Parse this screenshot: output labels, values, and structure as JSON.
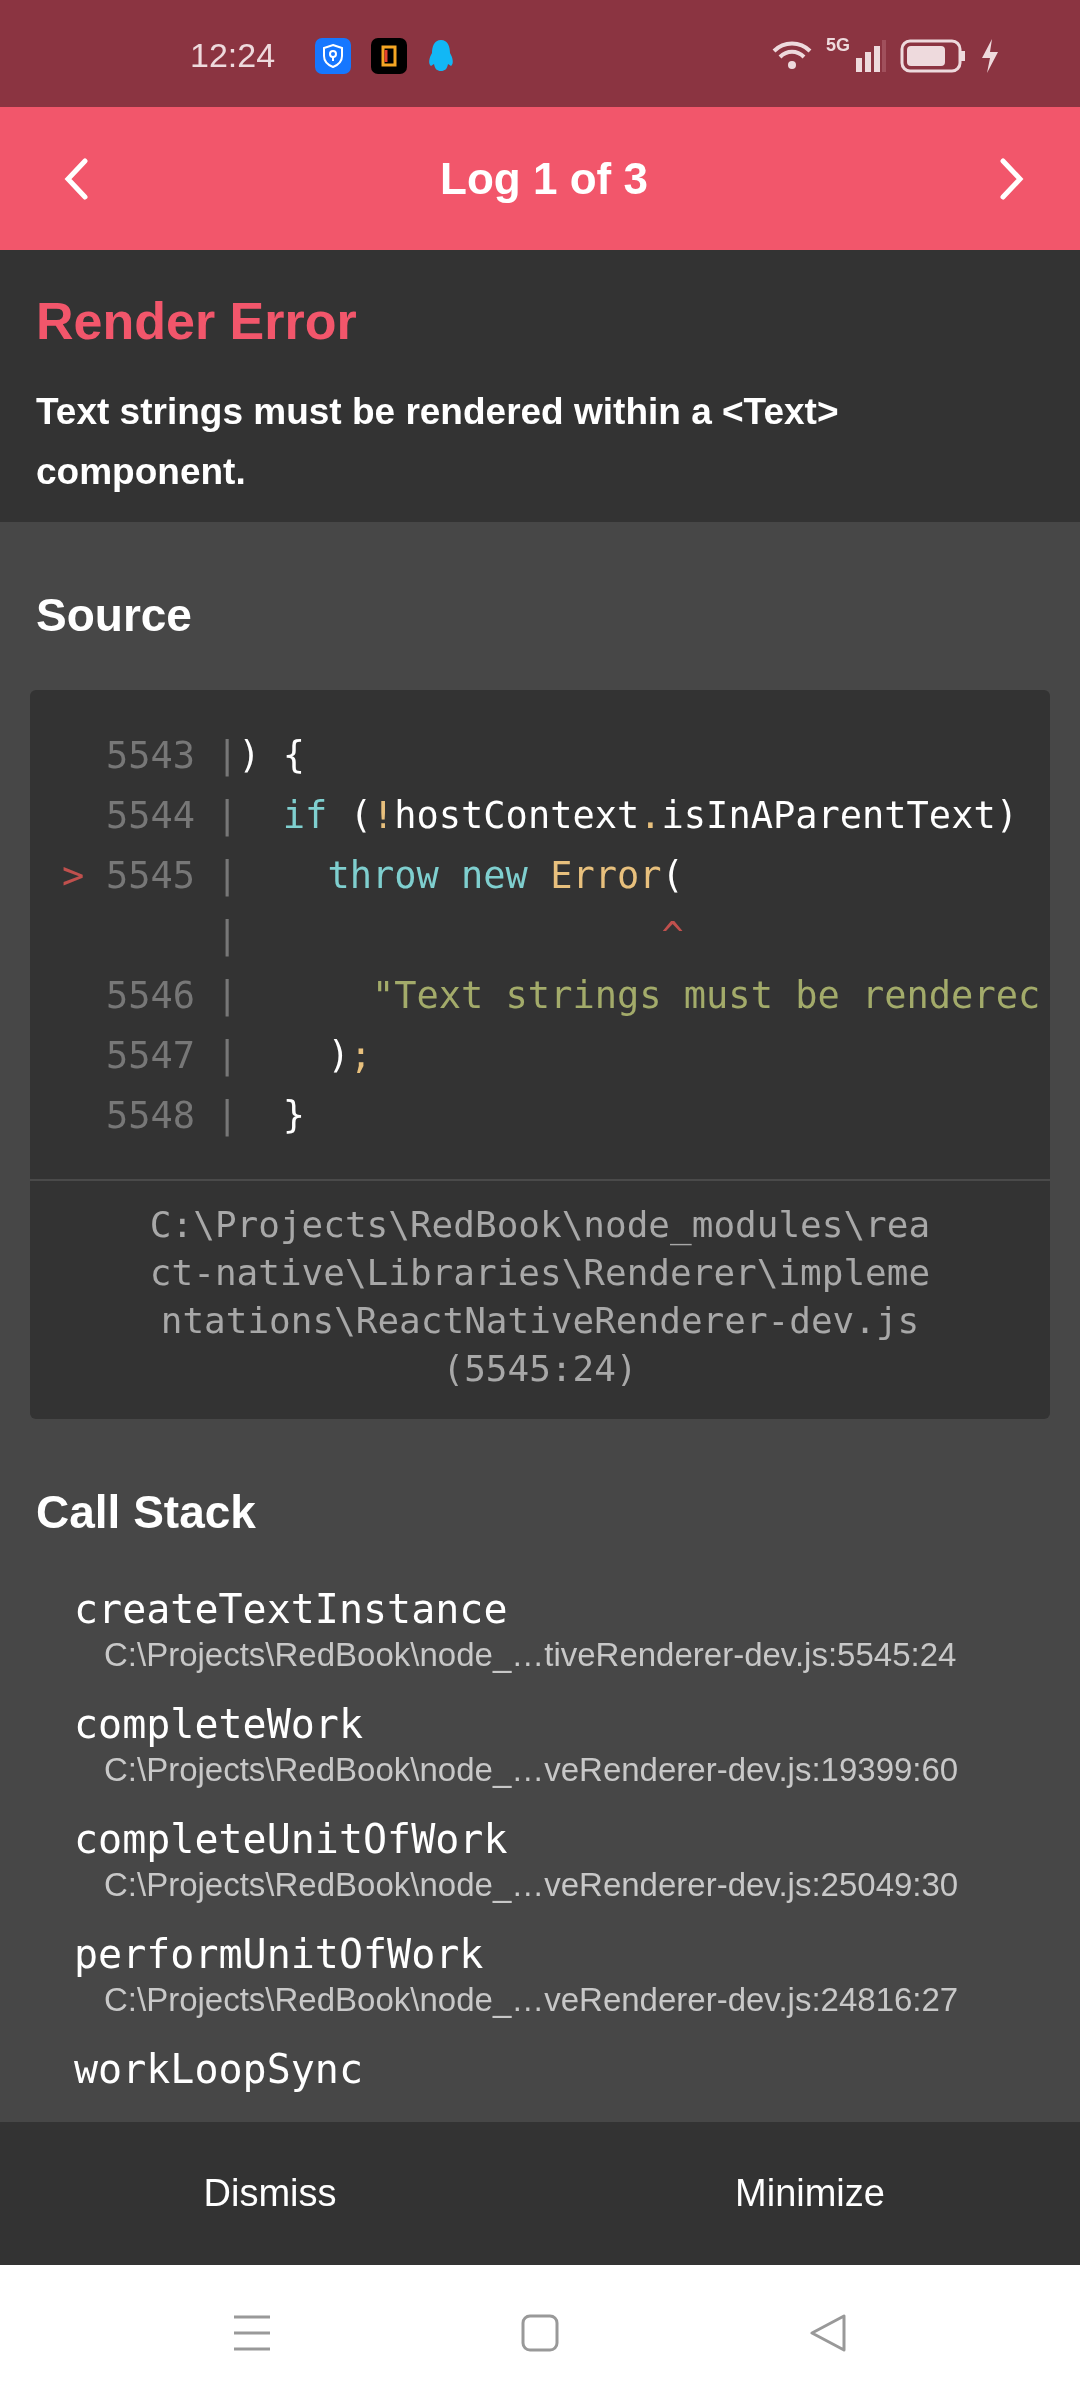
{
  "status_bar": {
    "time": "12:24",
    "network": "5G"
  },
  "header": {
    "title": "Log 1 of 3"
  },
  "error": {
    "title": "Render Error",
    "message": "Text strings must be rendered within a <Text> component."
  },
  "source": {
    "heading": "Source",
    "lines": [
      {
        "number": "5543",
        "separator": "|",
        "tokens": [
          {
            "kind": "plain",
            "text": ") {"
          }
        ]
      },
      {
        "number": "5544",
        "separator": "|",
        "tokens": [
          {
            "kind": "keyword",
            "text": "  if"
          },
          {
            "kind": "plain",
            "text": " ("
          },
          {
            "kind": "accent",
            "text": "!"
          },
          {
            "kind": "plain",
            "text": "hostContext"
          },
          {
            "kind": "accent",
            "text": "."
          },
          {
            "kind": "plain",
            "text": "isInAParentText)"
          }
        ]
      },
      {
        "marker": ">",
        "number": "5545",
        "separator": "|",
        "tokens": [
          {
            "kind": "keyword",
            "text": "    throw new"
          },
          {
            "kind": "accent",
            "text": " Error"
          },
          {
            "kind": "plain",
            "text": "("
          }
        ]
      },
      {
        "separator": "|",
        "tokens": [
          {
            "kind": "pointer",
            "text": "                   ^"
          }
        ]
      },
      {
        "number": "5546",
        "separator": "|",
        "tokens": [
          {
            "kind": "string",
            "text": "      \"Text strings must be renderec"
          }
        ]
      },
      {
        "number": "5547",
        "separator": "|",
        "tokens": [
          {
            "kind": "plain",
            "text": "    )"
          },
          {
            "kind": "accent",
            "text": ";"
          }
        ]
      },
      {
        "number": "5548",
        "separator": "|",
        "tokens": [
          {
            "kind": "plain",
            "text": "  }"
          }
        ]
      }
    ],
    "location": {
      "path": "C:\\Projects\\RedBook\\node_modules\\react-native\\Libraries\\Renderer\\implementations\\ReactNativeRenderer-dev.js",
      "position": "(5545:24)"
    }
  },
  "call_stack": {
    "heading": "Call Stack",
    "frames": [
      {
        "name": "createTextInstance",
        "file": "C:\\Projects\\RedBook\\node_…tiveRenderer-dev.js:5545:24"
      },
      {
        "name": "completeWork",
        "file": "C:\\Projects\\RedBook\\node_…veRenderer-dev.js:19399:60"
      },
      {
        "name": "completeUnitOfWork",
        "file": "C:\\Projects\\RedBook\\node_…veRenderer-dev.js:25049:30"
      },
      {
        "name": "performUnitOfWork",
        "file": "C:\\Projects\\RedBook\\node_…veRenderer-dev.js:24816:27"
      },
      {
        "name": "workLoopSync"
      }
    ]
  },
  "footer": {
    "buttons": [
      "Dismiss",
      "Minimize"
    ]
  }
}
